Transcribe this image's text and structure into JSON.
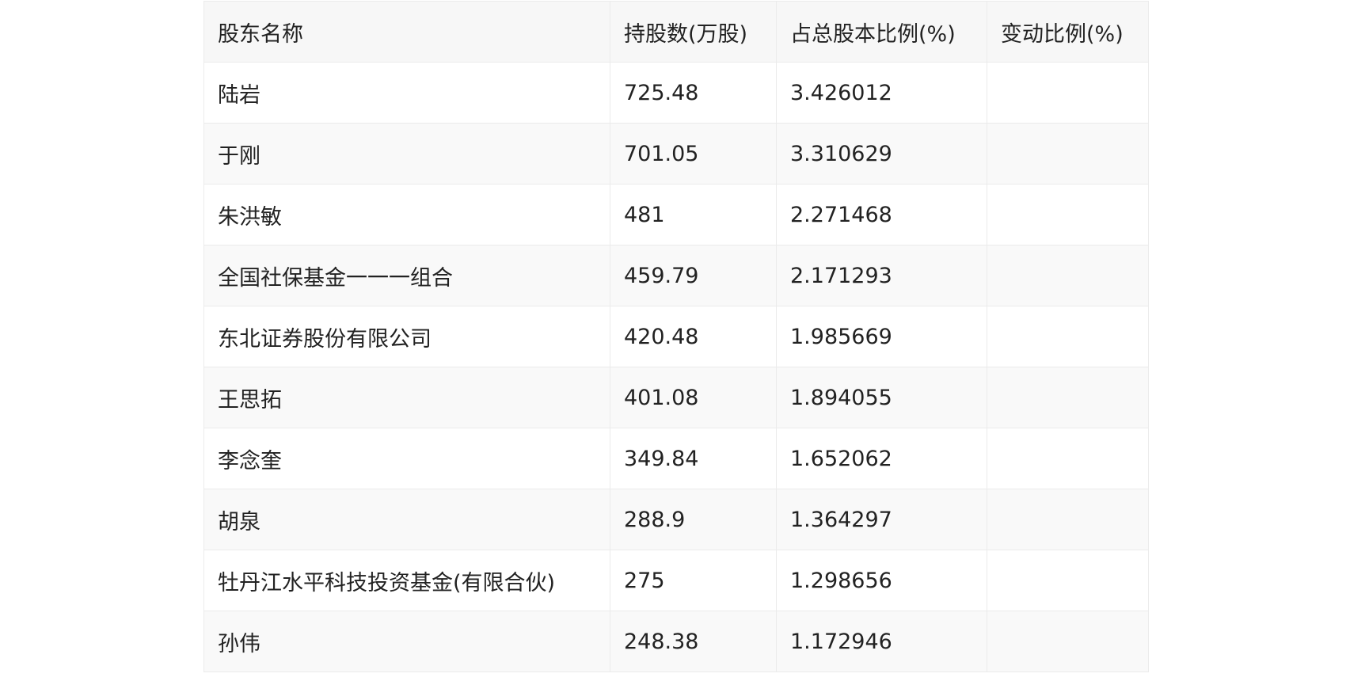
{
  "table": {
    "headers": [
      "股东名称",
      "持股数(万股)",
      "占总股本比例(%)",
      "变动比例(%)"
    ],
    "rows": [
      [
        "陆岩",
        "725.48",
        "3.426012",
        ""
      ],
      [
        "于刚",
        "701.05",
        "3.310629",
        ""
      ],
      [
        "朱洪敏",
        "481",
        "2.271468",
        ""
      ],
      [
        "全国社保基金一一一组合",
        "459.79",
        "2.171293",
        ""
      ],
      [
        "东北证券股份有限公司",
        "420.48",
        "1.985669",
        ""
      ],
      [
        "王思拓",
        "401.08",
        "1.894055",
        ""
      ],
      [
        "李念奎",
        "349.84",
        "1.652062",
        ""
      ],
      [
        "胡泉",
        "288.9",
        "1.364297",
        ""
      ],
      [
        "牡丹江水平科技投资基金(有限合伙)",
        "275",
        "1.298656",
        ""
      ],
      [
        "孙伟",
        "248.38",
        "1.172946",
        ""
      ]
    ]
  }
}
